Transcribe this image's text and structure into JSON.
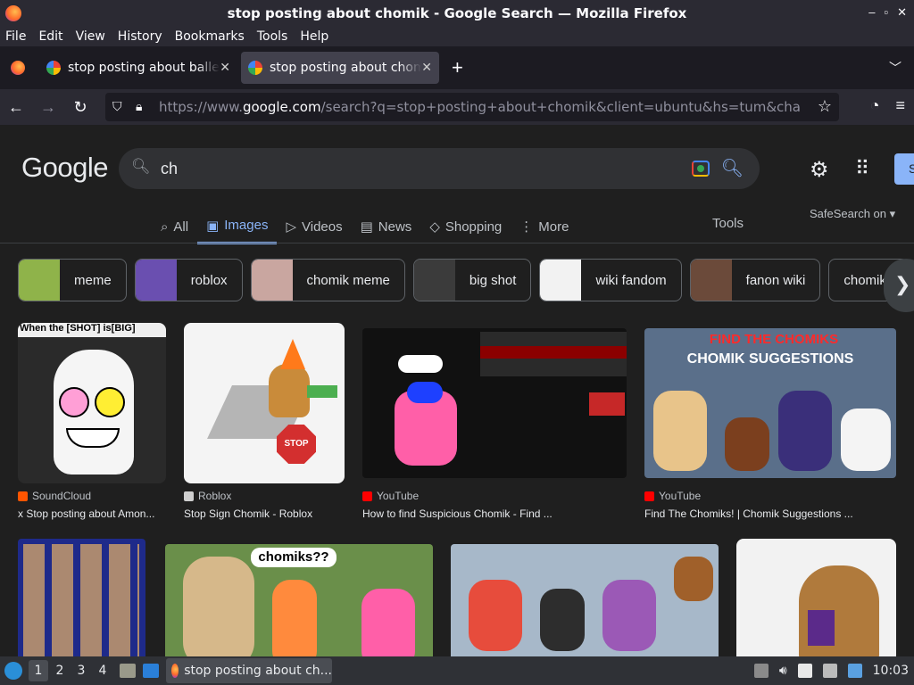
{
  "window": {
    "title": "stop posting about chomik - Google Search — Mozilla Firefox",
    "controls": [
      "–",
      "▫",
      "✕"
    ]
  },
  "menu": [
    "File",
    "Edit",
    "View",
    "History",
    "Bookmarks",
    "Tools",
    "Help"
  ],
  "tabs": [
    {
      "title": "stop posting about baller",
      "close": "✕"
    },
    {
      "title": "stop posting about chomik",
      "close": "✕"
    }
  ],
  "newtab": "+",
  "url": {
    "prefix": "https://www.",
    "domain": "google.com",
    "path": "/search?q=stop+posting+about+chomik&client=ubuntu&hs=tum&channel=fs"
  },
  "google": {
    "logo": "Google",
    "query": "ch",
    "search_tabs": [
      {
        "icon": "⌕",
        "label": "All"
      },
      {
        "icon": "▣",
        "label": "Images"
      },
      {
        "icon": "▷",
        "label": "Videos"
      },
      {
        "icon": "▤",
        "label": "News"
      },
      {
        "icon": "◇",
        "label": "Shopping"
      },
      {
        "icon": "⋮",
        "label": "More"
      }
    ],
    "tools": "Tools",
    "safesearch": "SafeSearch on ▾",
    "signin_initial": "S"
  },
  "chips": [
    {
      "label": "meme",
      "color": "#8fb34a"
    },
    {
      "label": "roblox",
      "color": "#6a4fb0"
    },
    {
      "label": "chomik meme",
      "color": "#c9a6a0"
    },
    {
      "label": "big shot",
      "color": "#3b3b3b"
    },
    {
      "label": "wiki fandom",
      "color": "#f2f2f2"
    },
    {
      "label": "fanon wiki",
      "color": "#6b4a3a"
    },
    {
      "label": "chomika",
      "color": ""
    }
  ],
  "results": [
    {
      "source": "SoundCloud",
      "caption": "x Stop posting about Amon...",
      "fav": "#ff5500",
      "bg": "#2a2a2a"
    },
    {
      "source": "Roblox",
      "caption": "Stop Sign Chomik - Roblox",
      "fav": "#cfcfcf",
      "bg": "#f4f4f4"
    },
    {
      "source": "YouTube",
      "caption": "How to find Suspicious Chomik - Find ...",
      "fav": "#ff0000",
      "bg": "#111111"
    },
    {
      "source": "YouTube",
      "caption": "Find The Chomiks! | Chomik Suggestions ...",
      "fav": "#ff0000",
      "bg": "#5a6f8a"
    },
    {
      "source": "",
      "caption": "",
      "fav": "",
      "bg": "#1e2a8a"
    },
    {
      "source": "",
      "caption": "chomiks??",
      "fav": "",
      "bg": "#6a8f4a"
    },
    {
      "source": "",
      "caption": "",
      "fav": "",
      "bg": "#a7b8c9"
    },
    {
      "source": "",
      "caption": "",
      "fav": "",
      "bg": "#f2f2f2"
    }
  ],
  "taskbar": {
    "workspaces": [
      "1",
      "2",
      "3",
      "4"
    ],
    "app_title": "stop posting about ch...",
    "clock": "10:03"
  }
}
